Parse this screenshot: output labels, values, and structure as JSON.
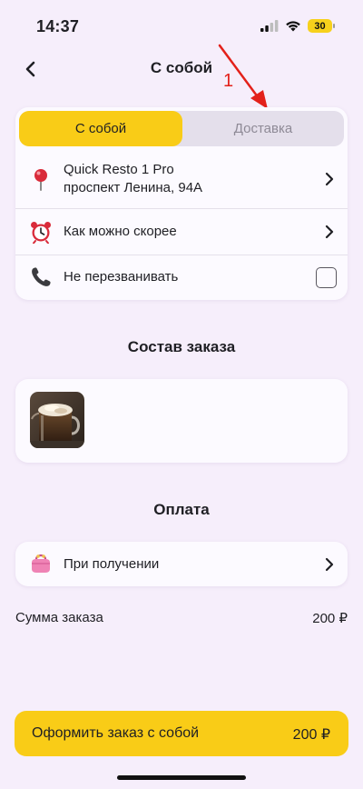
{
  "status_bar": {
    "time": "14:37",
    "battery": "30",
    "icons": [
      "signal-icon",
      "wifi-icon",
      "battery-icon"
    ]
  },
  "header": {
    "title": "С собой",
    "back_icon": "chevron-left-icon"
  },
  "annotation": {
    "label": "1",
    "color": "#e3211a"
  },
  "order_type": {
    "tabs": [
      {
        "label": "С собой",
        "active": true
      },
      {
        "label": "Доставка",
        "active": false
      }
    ]
  },
  "pickup": {
    "location": {
      "icon": "pin-icon",
      "name": "Quick Resto 1 Pro",
      "address": "проспект Ленина, 94А"
    },
    "time": {
      "icon": "alarm-clock-icon",
      "label": "Как можно скорее"
    },
    "callback": {
      "icon": "phone-icon",
      "label": "Не перезванивать",
      "checked": false
    }
  },
  "order_items": {
    "title": "Состав заказа",
    "items": [
      {
        "image": "coffee-drink-photo"
      }
    ]
  },
  "payment": {
    "title": "Оплата",
    "method": {
      "icon": "purse-icon",
      "label": "При получении"
    }
  },
  "summary": {
    "label": "Сумма заказа",
    "value": "200 ₽"
  },
  "checkout": {
    "label": "Оформить заказ с собой",
    "amount": "200 ₽"
  },
  "colors": {
    "accent": "#f9cc17",
    "background": "#f6eefb",
    "card": "#fcfaff",
    "inactive_tab": "#e4dfeb"
  }
}
